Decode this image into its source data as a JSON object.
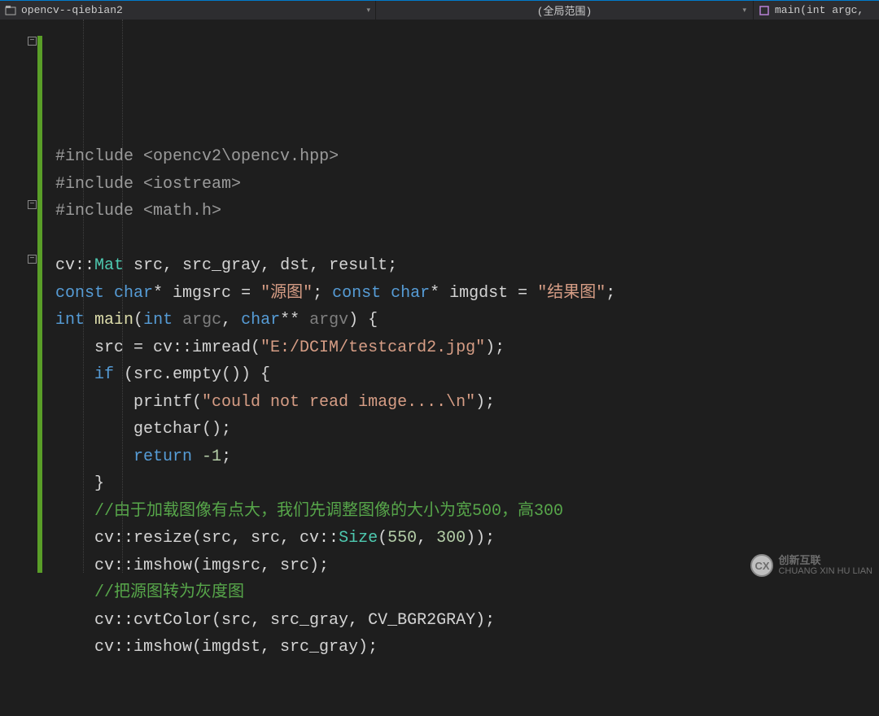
{
  "navbar": {
    "project": "opencv--qiebian2",
    "scope": "(全局范围)",
    "function": "main(int argc,"
  },
  "code": {
    "lines": [
      {
        "html": "<span class='dir'>#include</span> <span class='incl'>&lt;opencv2\\opencv.hpp&gt;</span>"
      },
      {
        "html": "<span class='dir'>#include</span> <span class='incl'>&lt;iostream&gt;</span>"
      },
      {
        "html": "<span class='dir'>#include</span> <span class='incl'>&lt;math.h&gt;</span>"
      },
      {
        "html": ""
      },
      {
        "html": "<span class='ns'>cv::</span><span class='type'>Mat</span> src, src_gray, dst, result;"
      },
      {
        "html": "<span class='kw'>const</span> <span class='kw'>char</span>* imgsrc = <span class='str'>\"源图\"</span>; <span class='kw'>const</span> <span class='kw'>char</span>* imgdst = <span class='str'>\"结果图\"</span>;"
      },
      {
        "html": "<span class='kw'>int</span> <span class='fn'>main</span>(<span class='kw'>int</span> <span class='param'>argc</span>, <span class='kw'>char</span>** <span class='param'>argv</span>) {"
      },
      {
        "html": "    src = cv::imread(<span class='str'>\"E:/DCIM/testcard2.jpg\"</span>);"
      },
      {
        "html": "    <span class='kw'>if</span> (src.empty()) {"
      },
      {
        "html": "        printf(<span class='str'>\"could not read image....\\n\"</span>);"
      },
      {
        "html": "        getchar();"
      },
      {
        "html": "        <span class='kw'>return</span> <span class='num'>-1</span>;"
      },
      {
        "html": "    }"
      },
      {
        "html": "    <span class='cmt'>//由于加载图像有点大，我们先调整图像的大小为宽500，高300</span>"
      },
      {
        "html": "    cv::resize(src, src, cv::<span class='type'>Size</span>(<span class='num'>550</span>, <span class='num'>300</span>));"
      },
      {
        "html": "    cv::imshow(imgsrc, src);"
      },
      {
        "html": "    <span class='cmt'>//把源图转为灰度图</span>"
      },
      {
        "html": "    cv::cvtColor(src, src_gray, CV_BGR2GRAY);"
      },
      {
        "html": "    cv::imshow(imgdst, src_gray);"
      }
    ]
  },
  "folds": [
    {
      "line": 0,
      "symbol": "−"
    },
    {
      "line": 6,
      "symbol": "−"
    },
    {
      "line": 8,
      "symbol": "−"
    }
  ],
  "watermark": {
    "logo": "CX",
    "cn": "创新互联",
    "en": "CHUANG XIN HU LIAN"
  }
}
